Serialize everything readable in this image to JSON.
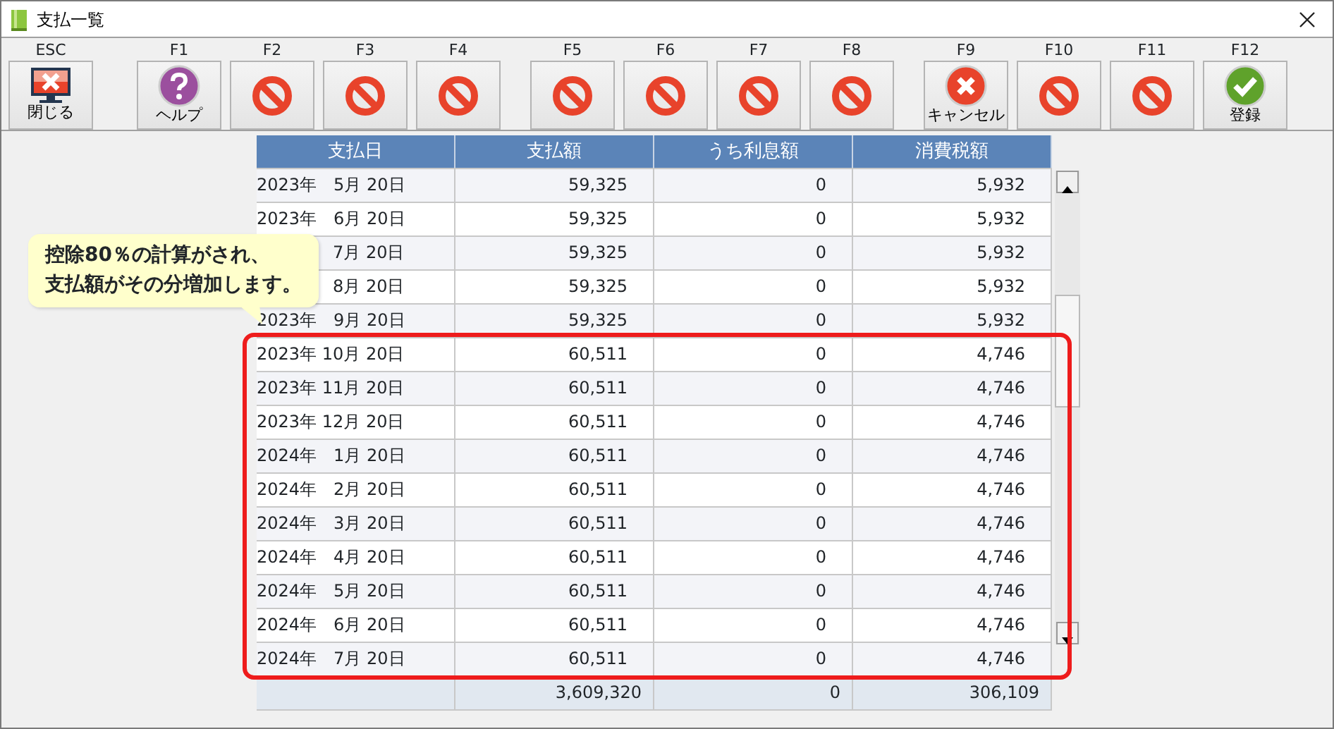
{
  "window": {
    "title": "支払一覧"
  },
  "function_keys": [
    {
      "key": "ESC",
      "label": "閉じる",
      "kind": "close"
    },
    {
      "key": "F1",
      "label": "ヘルプ",
      "kind": "help"
    },
    {
      "key": "F2",
      "kind": "unavailable"
    },
    {
      "key": "F3",
      "kind": "unavailable"
    },
    {
      "key": "F4",
      "kind": "unavailable"
    },
    {
      "key": "F5",
      "kind": "unavailable"
    },
    {
      "key": "F6",
      "kind": "unavailable"
    },
    {
      "key": "F7",
      "kind": "unavailable"
    },
    {
      "key": "F8",
      "kind": "unavailable"
    },
    {
      "key": "F9",
      "label": "キャンセル",
      "kind": "cancel"
    },
    {
      "key": "F10",
      "kind": "unavailable"
    },
    {
      "key": "F11",
      "kind": "unavailable"
    },
    {
      "key": "F12",
      "label": "登録",
      "kind": "ok"
    }
  ],
  "table": {
    "columns": [
      "支払日",
      "支払額",
      "うち利息額",
      "消費税額"
    ],
    "rows": [
      {
        "date": "2023年　5月 20日",
        "amount": "59,325",
        "interest": "0",
        "tax": "5,932"
      },
      {
        "date": "2023年　6月 20日",
        "amount": "59,325",
        "interest": "0",
        "tax": "5,932"
      },
      {
        "date": "7月 20日",
        "amount": "59,325",
        "interest": "0",
        "tax": "5,932"
      },
      {
        "date": "8月 20日",
        "amount": "59,325",
        "interest": "0",
        "tax": "5,932"
      },
      {
        "date": "2023年　9月 20日",
        "amount": "59,325",
        "interest": "0",
        "tax": "5,932"
      }
    ],
    "highlighted_rows": [
      {
        "date": "2023年 10月 20日",
        "amount": "60,511",
        "interest": "0",
        "tax": "4,746"
      },
      {
        "date": "2023年 11月 20日",
        "amount": "60,511",
        "interest": "0",
        "tax": "4,746"
      },
      {
        "date": "2023年 12月 20日",
        "amount": "60,511",
        "interest": "0",
        "tax": "4,746"
      },
      {
        "date": "2024年　1月 20日",
        "amount": "60,511",
        "interest": "0",
        "tax": "4,746"
      },
      {
        "date": "2024年　2月 20日",
        "amount": "60,511",
        "interest": "0",
        "tax": "4,746"
      },
      {
        "date": "2024年　3月 20日",
        "amount": "60,511",
        "interest": "0",
        "tax": "4,746"
      },
      {
        "date": "2024年　4月 20日",
        "amount": "60,511",
        "interest": "0",
        "tax": "4,746"
      },
      {
        "date": "2024年　5月 20日",
        "amount": "60,511",
        "interest": "0",
        "tax": "4,746"
      },
      {
        "date": "2024年　6月 20日",
        "amount": "60,511",
        "interest": "0",
        "tax": "4,746"
      },
      {
        "date": "2024年　7月 20日",
        "amount": "60,511",
        "interest": "0",
        "tax": "4,746"
      }
    ],
    "totals": {
      "amount": "3,609,320",
      "interest": "0",
      "tax": "306,109"
    }
  },
  "callout": {
    "lines": [
      "控除80％の計算がされ、",
      "支払額がその分増加します。"
    ]
  }
}
